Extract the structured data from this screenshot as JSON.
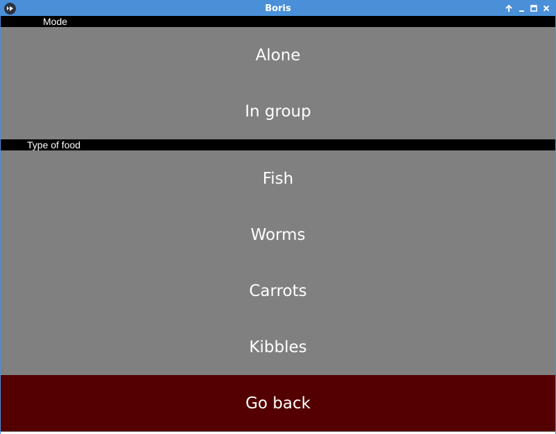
{
  "window": {
    "title": "Boris",
    "icons": {
      "app": "kivy-logo-icon",
      "keep_above": "arrow-up-icon",
      "minimize": "minimize-icon",
      "maximize": "maximize-icon",
      "close": "close-icon"
    },
    "colors": {
      "titlebar": "#4a90d9",
      "background": "#808080",
      "section_header": "#000000",
      "back_button": "#540000",
      "text": "#ffffff"
    }
  },
  "mode_section": {
    "label": "Mode",
    "options": [
      "Alone",
      "In group"
    ]
  },
  "food_section": {
    "label": "Type of food",
    "options": [
      "Fish",
      "Worms",
      "Carrots",
      "Kibbles"
    ]
  },
  "go_back": {
    "label": "Go back"
  }
}
